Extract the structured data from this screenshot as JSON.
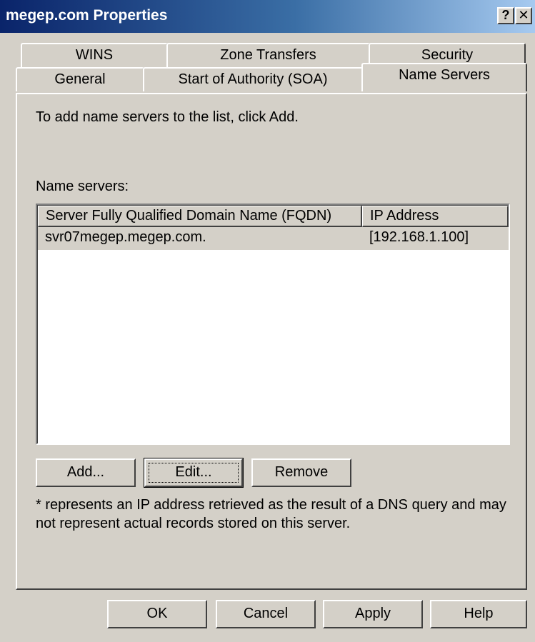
{
  "window": {
    "title": "megep.com Properties",
    "help_button": "?",
    "close_button": "✕"
  },
  "tabs": {
    "row_back": [
      "WINS",
      "Zone Transfers",
      "Security"
    ],
    "row_front": [
      "General",
      "Start of Authority (SOA)",
      "Name Servers"
    ],
    "active": "Name Servers"
  },
  "panel": {
    "instruction": "To add name servers to the list, click Add.",
    "list_label": "Name servers:",
    "columns": [
      "Server Fully Qualified Domain Name (FQDN)",
      "IP Address"
    ],
    "rows": [
      {
        "fqdn": "svr07megep.megep.com.",
        "ip": "[192.168.1.100]"
      }
    ],
    "buttons": {
      "add": "Add...",
      "edit": "Edit...",
      "remove": "Remove"
    },
    "note_line1": "* represents an IP address retrieved as the result of a DNS query and may",
    "note_line2": "not represent actual records stored on this server."
  },
  "footer": {
    "ok": "OK",
    "cancel": "Cancel",
    "apply": "Apply",
    "help": "Help"
  },
  "colors": {
    "dialog_face": "#d4d0c8",
    "titlebar_start": "#0a246a",
    "titlebar_end": "#a6caf0",
    "selected_row": "#d4d0c8"
  }
}
